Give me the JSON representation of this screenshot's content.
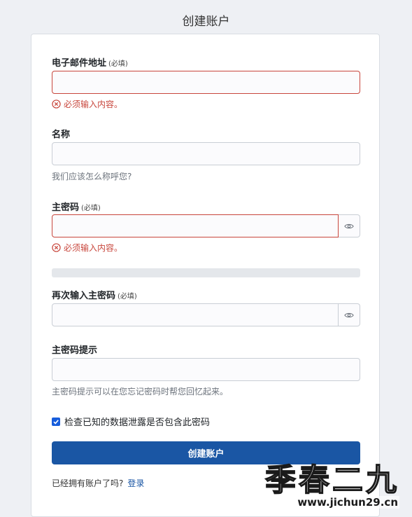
{
  "page": {
    "title": "创建账户"
  },
  "form": {
    "email": {
      "label": "电子邮件地址",
      "required": "(必填)",
      "value": "",
      "error": "必须输入内容。"
    },
    "name": {
      "label": "名称",
      "value": "",
      "helper": "我们应该怎么称呼您?"
    },
    "master_password": {
      "label": "主密码",
      "required": "(必填)",
      "value": "",
      "error": "必须输入内容。",
      "strength": 0
    },
    "confirm_password": {
      "label": "再次输入主密码",
      "required": "(必填)",
      "value": ""
    },
    "hint": {
      "label": "主密码提示",
      "value": "",
      "helper": "主密码提示可以在您忘记密码时帮您回忆起来。"
    },
    "breach_check": {
      "label": "检查已知的数据泄露是否包含此密码",
      "checked": true
    },
    "submit_label": "创建账户",
    "footer": {
      "text": "已经拥有账户了吗?",
      "login_link": "登录"
    }
  },
  "watermark": {
    "title": "季春二九",
    "url": "www.jichun29.cn"
  },
  "colors": {
    "accent": "#1a56a4",
    "error": "#c8463c",
    "background": "#eef0f4"
  },
  "icons": [
    "error-circle-icon",
    "eye-icon",
    "checkmark-icon"
  ]
}
